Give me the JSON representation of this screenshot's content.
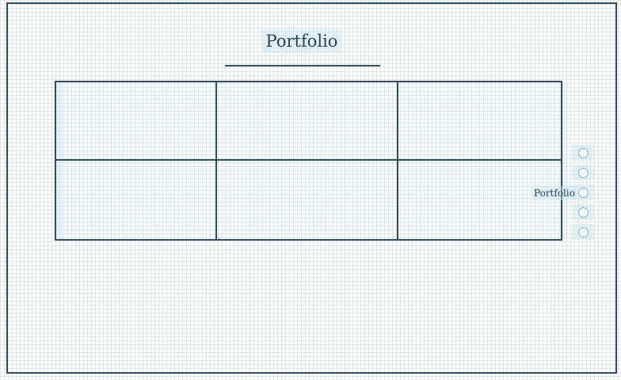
{
  "page": {
    "title": "Portfolio"
  },
  "portfolio_grid": {
    "rows": 2,
    "columns": 3
  },
  "pager": {
    "label": "Portfolio",
    "dots": 5
  },
  "colors": {
    "line": "#334d5c",
    "highlight": "#c8e4f0",
    "dot_border": "#8ab9c8"
  }
}
